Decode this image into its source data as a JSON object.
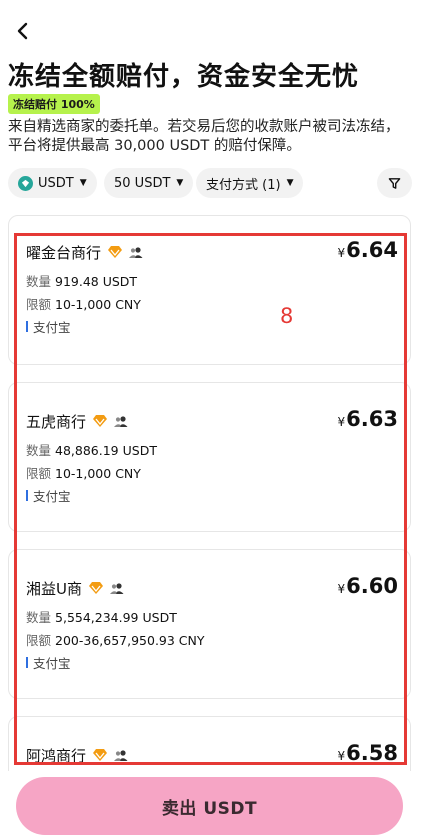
{
  "header": {
    "title": "冻结全额赔付，资金安全无忧",
    "badge": "冻结赔付 100%",
    "description": "来自精选商家的委托单。若交易后您的收款账户被司法冻结，平台将提供最高 30,000 USDT 的赔付保障。"
  },
  "filters": {
    "coin": "USDT",
    "amount": "50 USDT",
    "payment": "支付方式 (1)"
  },
  "labels": {
    "quantity": "数量",
    "limit": "限额",
    "currency_symbol": "¥"
  },
  "merchants": [
    {
      "name": "曜金台商行",
      "price": "6.64",
      "quantity": "919.48 USDT",
      "limit": "10-1,000 CNY",
      "payment": "支付宝"
    },
    {
      "name": "五虎商行",
      "price": "6.63",
      "quantity": "48,886.19 USDT",
      "limit": "10-1,000 CNY",
      "payment": "支付宝"
    },
    {
      "name": "湘益U商",
      "price": "6.60",
      "quantity": "5,554,234.99 USDT",
      "limit": "200-36,657,950.93 CNY",
      "payment": "支付宝"
    },
    {
      "name": "阿鸿商行",
      "price": "6.58",
      "quantity": "",
      "limit": "",
      "payment": ""
    }
  ],
  "annotation": {
    "number": "8"
  },
  "footer": {
    "sell_label": "卖出 USDT"
  },
  "colors": {
    "badge_bg": "#b6f24c",
    "sell_button": "#f6a5c5",
    "highlight": "#e53935",
    "diamond": "#f39c12",
    "payment_bar": "#2f6fe0"
  }
}
